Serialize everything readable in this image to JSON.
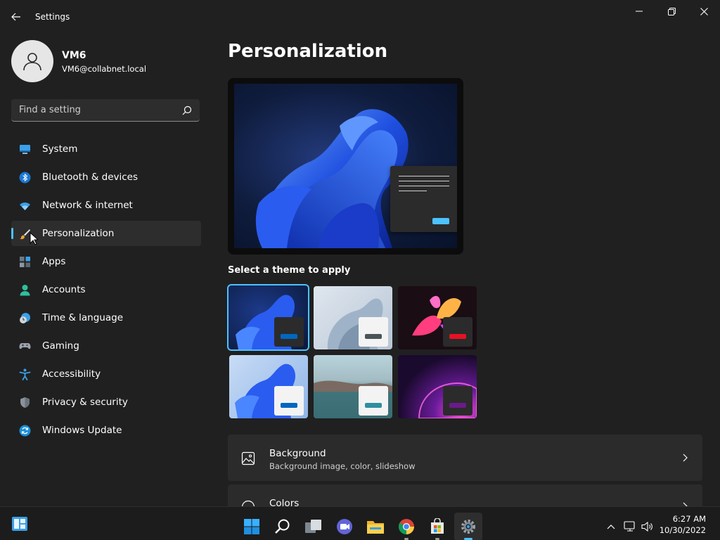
{
  "window": {
    "title": "Settings"
  },
  "profile": {
    "name": "VM6",
    "email": "VM6@collabnet.local"
  },
  "search": {
    "placeholder": "Find a setting"
  },
  "sidebar": {
    "items": [
      {
        "label": "System",
        "icon": "system-icon"
      },
      {
        "label": "Bluetooth & devices",
        "icon": "bluetooth-icon"
      },
      {
        "label": "Network & internet",
        "icon": "wifi-icon"
      },
      {
        "label": "Personalization",
        "icon": "brush-icon",
        "selected": true
      },
      {
        "label": "Apps",
        "icon": "apps-icon"
      },
      {
        "label": "Accounts",
        "icon": "person-icon"
      },
      {
        "label": "Time & language",
        "icon": "clock-globe-icon"
      },
      {
        "label": "Gaming",
        "icon": "gamepad-icon"
      },
      {
        "label": "Accessibility",
        "icon": "accessibility-icon"
      },
      {
        "label": "Privacy & security",
        "icon": "shield-icon"
      },
      {
        "label": "Windows Update",
        "icon": "update-icon"
      }
    ]
  },
  "main": {
    "title": "Personalization",
    "themes_label": "Select a theme to apply",
    "themes": [
      {
        "name": "windows-dark",
        "accent": "#0067c0",
        "selected": true
      },
      {
        "name": "windows-light",
        "accent": "#4a5459"
      },
      {
        "name": "glow",
        "accent": "#e81123"
      },
      {
        "name": "captured-motion",
        "accent": "#0067c0"
      },
      {
        "name": "flow",
        "accent": "#2d8fa0"
      },
      {
        "name": "sunrise",
        "accent": "#6b1a8a"
      }
    ],
    "cards": [
      {
        "title": "Background",
        "subtitle": "Background image, color, slideshow",
        "icon": "image-icon"
      },
      {
        "title": "Colors",
        "subtitle": "",
        "icon": "palette-icon"
      }
    ]
  },
  "taskbar": {
    "time": "6:27 AM",
    "date": "10/30/2022",
    "apps": [
      "start-icon",
      "search-icon",
      "task-view-icon",
      "teams-icon",
      "file-explorer-icon",
      "chrome-icon",
      "store-icon",
      "settings-icon"
    ]
  },
  "colors": {
    "accent": "#4cc2ff",
    "background": "#202020",
    "card": "#2b2b2b"
  }
}
